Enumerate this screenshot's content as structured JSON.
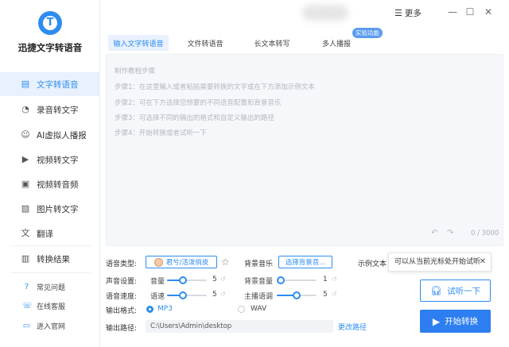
{
  "app": {
    "logo_text": "T",
    "title": "迅捷文字转语音"
  },
  "sidebar": {
    "items": [
      {
        "label": "文字转语音",
        "icon": "text-to-speech-icon",
        "active": true
      },
      {
        "label": "录音转文字",
        "icon": "mic-icon"
      },
      {
        "label": "AI虚拟人播报",
        "icon": "ai-avatar-icon"
      },
      {
        "label": "视频转文字",
        "icon": "video-icon"
      },
      {
        "label": "视频转音频",
        "icon": "video-audio-icon"
      },
      {
        "label": "图片转文字",
        "icon": "image-icon"
      },
      {
        "label": "翻译",
        "icon": "translate-icon"
      },
      {
        "label": "转换结果",
        "icon": "results-icon"
      }
    ],
    "links": [
      {
        "label": "常见问题",
        "icon": "help-icon"
      },
      {
        "label": "在线客服",
        "icon": "service-icon"
      },
      {
        "label": "进入官网",
        "icon": "website-icon"
      }
    ]
  },
  "titlebar": {
    "menu_label": "更多"
  },
  "tabs": [
    {
      "label": "输入文字转语音",
      "active": true
    },
    {
      "label": "文件转语音"
    },
    {
      "label": "长文本转写"
    },
    {
      "label": "多人播报"
    }
  ],
  "beta_badge": "实验功能",
  "editor": {
    "hints": [
      "制作教程步骤",
      "步骤1：在这里输入或者粘贴需要转换的文字或在下方添加示例文本",
      "步骤2：可在下方选择您想要的不同语音配置和背景音乐",
      "步骤3：可选择不同的输出的格式和自定义输出的路径",
      "步骤4：开始转换或者试听一下"
    ],
    "counter": "0 / 3000"
  },
  "settings": {
    "voice_type_label": "语音类型:",
    "voice_name": "君兮/活泼俏皮",
    "bg_music_label": "背景音乐",
    "bg_music_button": "选择背景音...",
    "example_text_label": "示例文本",
    "voice_settings_label": "声音设置:",
    "volume_label": "音量",
    "volume_value": "5",
    "bg_volume_label": "背景音量",
    "bg_volume_value": "1",
    "speed_label": "语音速度:",
    "speed_small_label": "语速",
    "speed_value": "5",
    "pitch_label": "主播语调",
    "pitch_value": "5",
    "format_label": "输出格式:",
    "format_mp3": "MP3",
    "format_wav": "WAV",
    "path_label": "输出路径:",
    "path_value": "C:\\Users\\Admin\\desktop",
    "change_path": "更改路径"
  },
  "tooltip": {
    "text": "可以从当前光标处开始试听"
  },
  "actions": {
    "listen": "试听一下",
    "start": "开始转换"
  },
  "colors": {
    "accent": "#2d8cf0",
    "primary_button": "#2d7ef0",
    "active_bg": "#e8f1fd"
  }
}
